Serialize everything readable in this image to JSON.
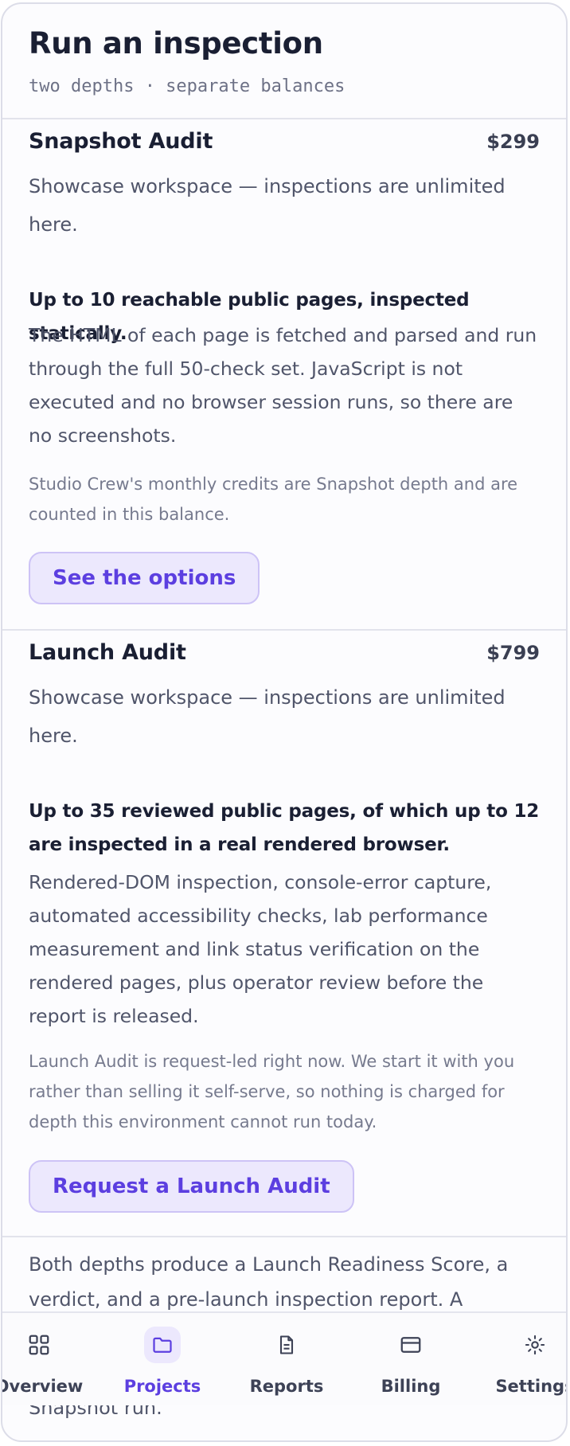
{
  "header": {
    "title": "Run an inspection",
    "subtitle": "two depths · separate balances"
  },
  "plans": [
    {
      "name": "Snapshot Audit",
      "price": "$299",
      "workspace_note": "Showcase workspace — inspections are unlimited here.",
      "scope": "Up to 10 reachable public pages, inspected statically.",
      "description": "The HTML of each page is fetched and parsed and run through the full 50-check set. JavaScript is not executed and no browser session runs, so there are no screenshots.",
      "fine_print": "Studio Crew's monthly credits are Snapshot depth and are counted in this balance.",
      "cta": "See the options"
    },
    {
      "name": "Launch Audit",
      "price": "$799",
      "workspace_note": "Showcase workspace — inspections are unlimited here.",
      "scope": "Up to 35 reviewed public pages, of which up to 12 are inspected in a real rendered browser.",
      "description": "Rendered-DOM inspection, console-error capture, automated accessibility checks, lab performance measurement and link status verification on the rendered pages, plus operator review before the report is released.",
      "fine_print": "Launch Audit is request-led right now. We start it with you rather than selling it self-serve, so nothing is charged for depth this environment cannot run today.",
      "cta": "Request a Launch Audit"
    }
  ],
  "footer": {
    "text_line1": "Both depths produce a Launch Readiness Score, a",
    "text_line2": "verdict, and a pre-launch inspection report. A",
    "text_tail": "Snapshot run."
  },
  "nav": {
    "items": [
      {
        "label": "Overview",
        "icon": "grid-icon"
      },
      {
        "label": "Projects",
        "icon": "folder-icon"
      },
      {
        "label": "Reports",
        "icon": "document-icon"
      },
      {
        "label": "Billing",
        "icon": "card-icon"
      },
      {
        "label": "Settings",
        "icon": "gear-icon"
      }
    ],
    "active": "Projects",
    "accent": "#5c3fe0"
  }
}
